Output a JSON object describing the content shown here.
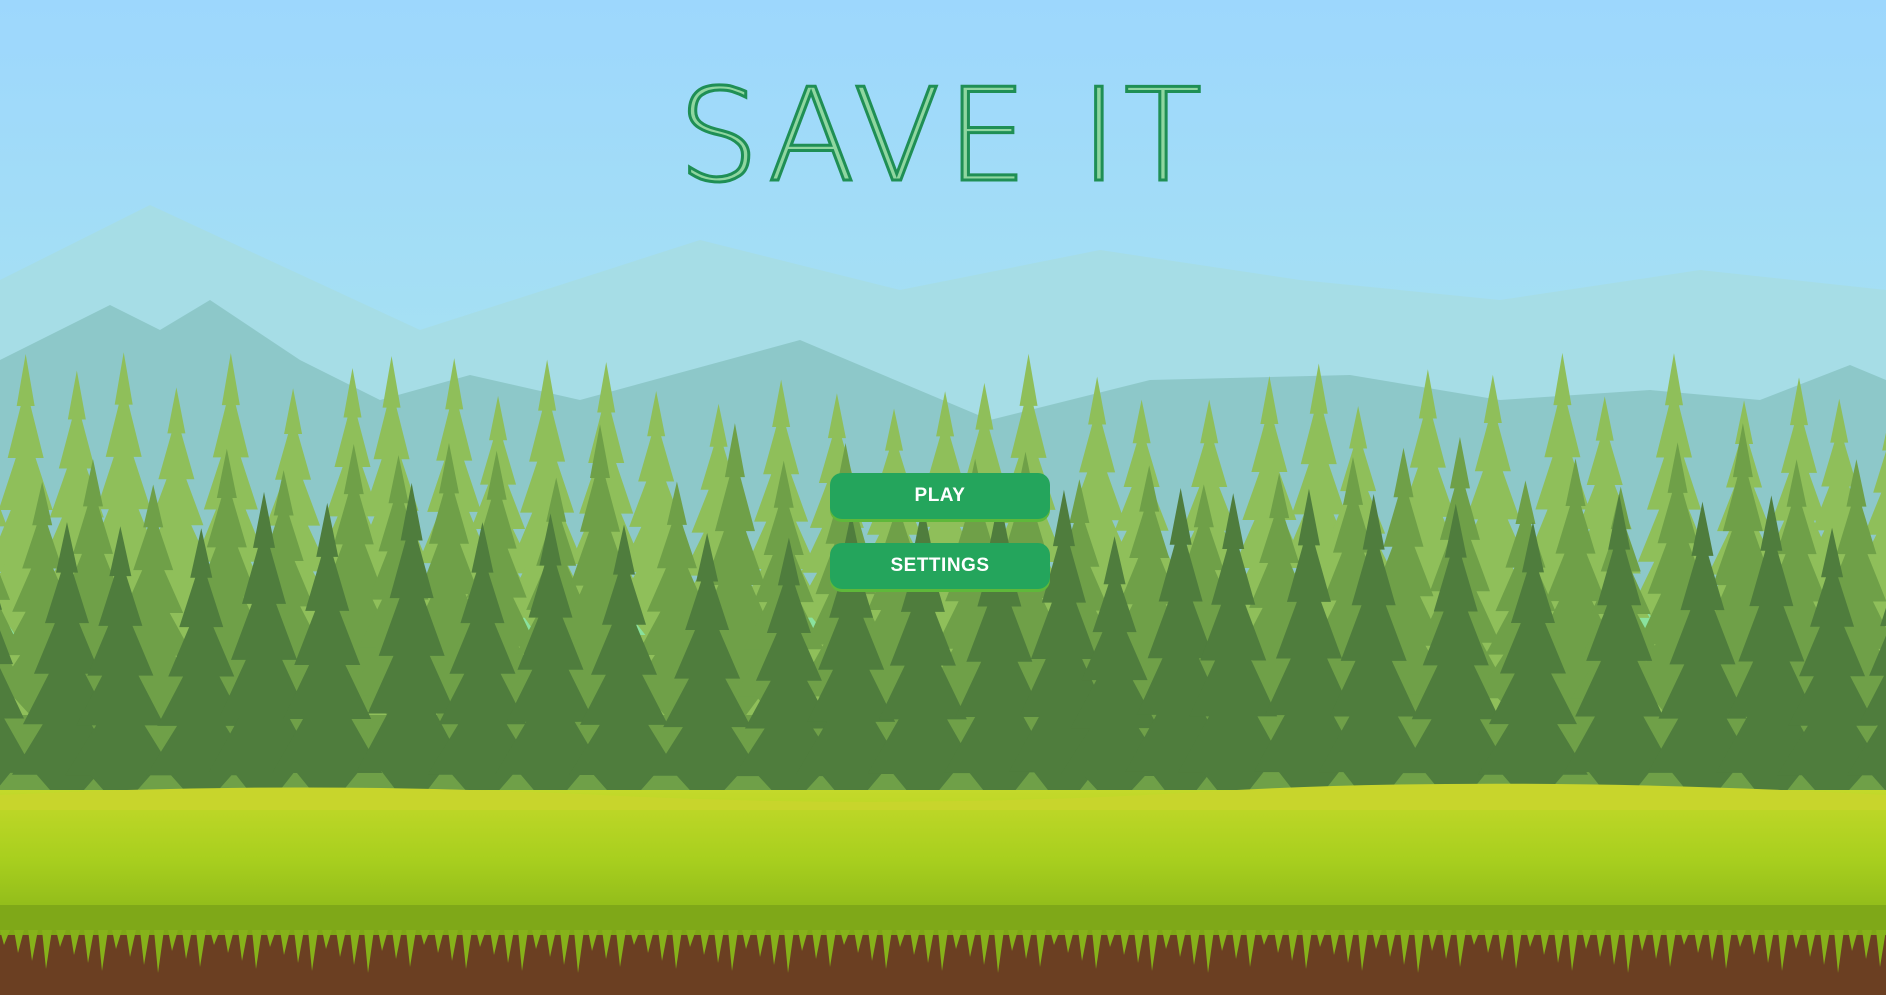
{
  "game": {
    "title": "SAVE IT",
    "buttons": {
      "play": "PLAY",
      "settings": "SETTINGS"
    }
  },
  "colors": {
    "button": "#24a55c",
    "title": "#27a35e",
    "sky": "#9dd7fb",
    "grass": "#a8cf1e"
  }
}
